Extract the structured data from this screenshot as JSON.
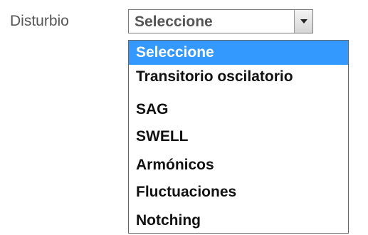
{
  "field": {
    "label": "Disturbio",
    "selected_value": "Seleccione"
  },
  "dropdown": {
    "options": [
      "Seleccione",
      "Transitorio oscilatorio",
      "SAG",
      "SWELL",
      "Armónicos",
      "Fluctuaciones",
      "Notching"
    ],
    "highlighted_option": "Seleccione"
  },
  "colors": {
    "highlight": "#3399ff",
    "label_text": "#555555"
  }
}
